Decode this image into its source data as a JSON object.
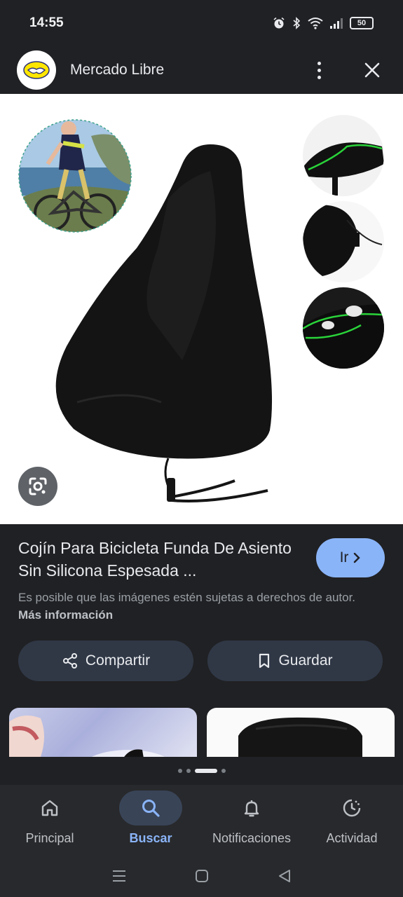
{
  "status_bar": {
    "time": "14:55",
    "battery": "50",
    "icons": [
      "alarm-icon",
      "bluetooth-icon",
      "wifi-icon",
      "signal-icon",
      "battery-icon"
    ]
  },
  "header": {
    "site_name": "Mercado Libre",
    "logo_icon": "mercado-libre-handshake-logo",
    "menu_icon": "more-vert-icon",
    "close_icon": "close-icon"
  },
  "product": {
    "title": "Cojín Para Bicicleta Funda De Asiento Sin Silicona Espesada ...",
    "go_button": "Ir",
    "rights_text": "Es posible que las imágenes estén sujetas a derechos de autor.",
    "more_info": "Más información",
    "share_label": "Compartir",
    "save_label": "Guardar"
  },
  "bottom_nav": {
    "items": [
      {
        "label": "Principal",
        "icon": "home-icon"
      },
      {
        "label": "Buscar",
        "icon": "search-icon",
        "active": true
      },
      {
        "label": "Notificaciones",
        "icon": "bell-icon"
      },
      {
        "label": "Actividad",
        "icon": "activity-icon"
      }
    ]
  },
  "colors": {
    "background": "#202124",
    "accent": "#8ab4f8",
    "button_bg": "#303846",
    "text": "#e8eaed",
    "muted": "#9aa0a6"
  }
}
